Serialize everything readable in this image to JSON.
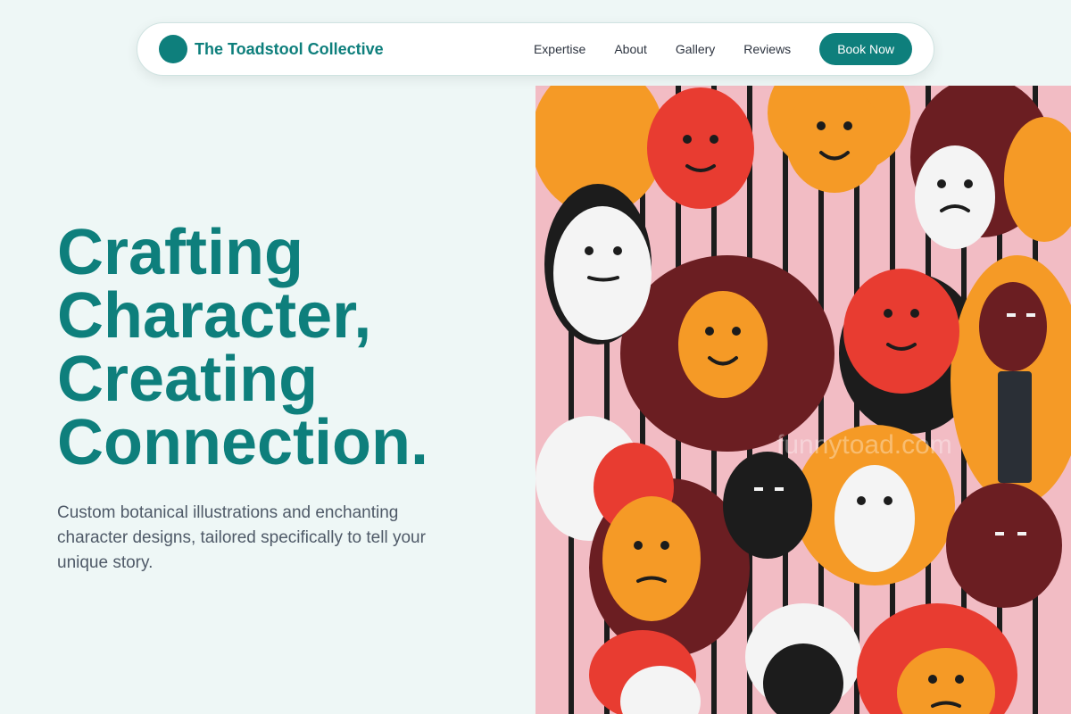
{
  "brand": {
    "name": "The Toadstool Collective"
  },
  "nav": {
    "links": [
      "Expertise",
      "About",
      "Gallery",
      "Reviews"
    ],
    "cta": "Book Now"
  },
  "hero": {
    "title_lines": [
      "Crafting",
      "Character,",
      "Creating",
      "Connection."
    ],
    "subtitle": "Custom botanical illustrations and enchanting character designs, tailored specifically to tell your unique story.",
    "image_watermark": "funnytoad.com"
  },
  "colors": {
    "accent": "#0e7f7c",
    "background": "#eef7f6"
  },
  "icons": {
    "logo": "logo-circle-icon"
  }
}
